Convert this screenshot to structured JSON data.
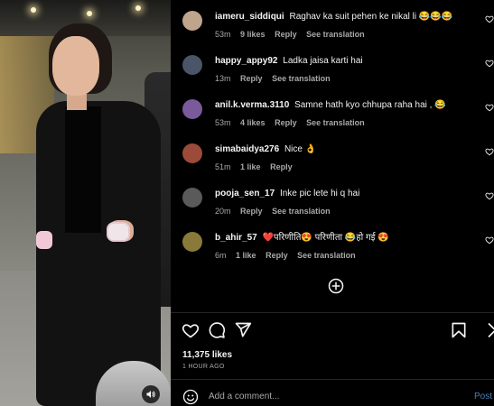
{
  "comments": [
    {
      "username": "iameru_siddiqui",
      "text": "Raghav ka suit pehen ke nikal li 😂😂😂",
      "time": "53m",
      "likes": "9 likes",
      "reply": "Reply",
      "translation": "See translation",
      "avatar_color": "#bfa58c"
    },
    {
      "username": "happy_appy92",
      "text": "Ladka jaisa karti hai",
      "time": "13m",
      "likes": "",
      "reply": "Reply",
      "translation": "See translation",
      "avatar_color": "#4a5568"
    },
    {
      "username": "anil.k.verma.3110",
      "text": "Samne hath kyo chhupa raha hai , 😂",
      "time": "53m",
      "likes": "4 likes",
      "reply": "Reply",
      "translation": "See translation",
      "avatar_color": "#7a5a9a"
    },
    {
      "username": "simabaidya276",
      "text": "Nice 👌",
      "time": "51m",
      "likes": "1 like",
      "reply": "Reply",
      "translation": "",
      "avatar_color": "#9c4a3a"
    },
    {
      "username": "pooja_sen_17",
      "text": "Inke pic lete hi q hai",
      "time": "20m",
      "likes": "",
      "reply": "Reply",
      "translation": "See translation",
      "avatar_color": "#5a5a5a"
    },
    {
      "username": "b_ahir_57",
      "text": "❤️परिणीति😍 परिणीता 😂हो गई 😍",
      "time": "6m",
      "likes": "1 like",
      "reply": "Reply",
      "translation": "See translation",
      "avatar_color": "#8a7a3a"
    }
  ],
  "post": {
    "likes": "11,375 likes",
    "time": "1 HOUR AGO"
  },
  "composer": {
    "placeholder": "Add a comment...",
    "post_label": "Post"
  },
  "icons": {
    "like": "heart-icon",
    "comment": "comment-icon",
    "share": "send-icon",
    "save": "bookmark-icon",
    "load_more": "plus-circle-icon",
    "emoji": "emoji-icon",
    "mute": "speaker-icon"
  },
  "colors": {
    "background": "#000000",
    "muted_text": "#a8a8a8",
    "post_button": "#4a7fb5"
  }
}
